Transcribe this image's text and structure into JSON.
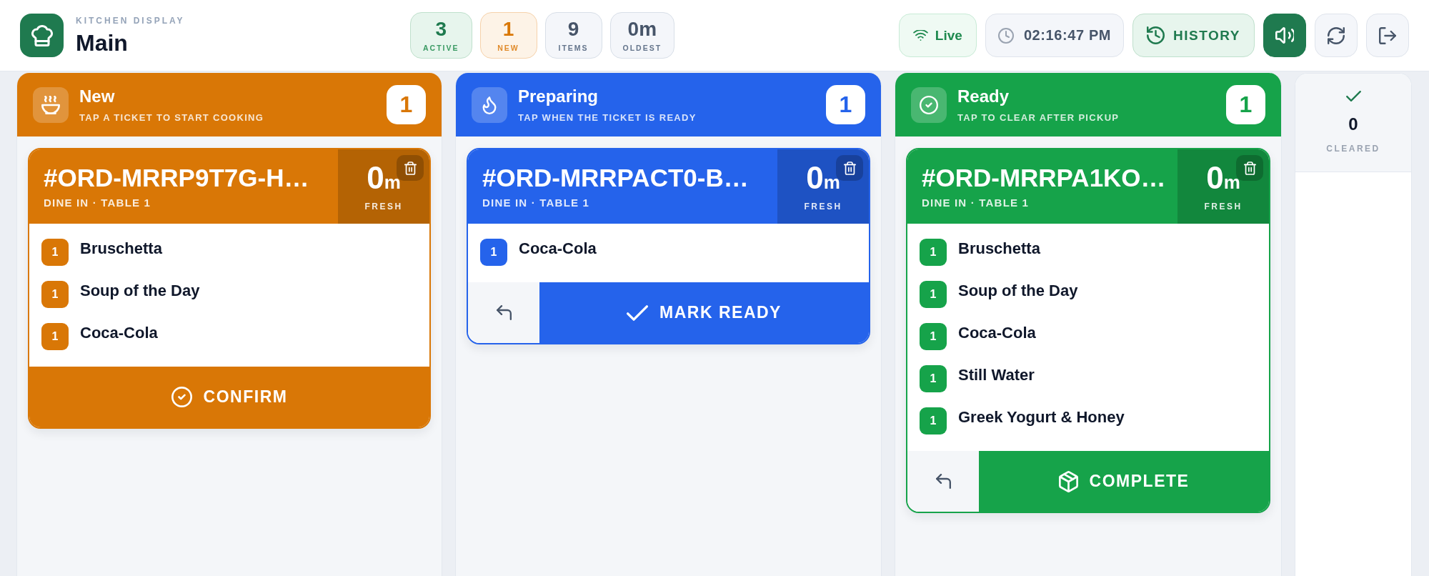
{
  "header": {
    "app_label": "KITCHEN DISPLAY",
    "station": "Main"
  },
  "stats": [
    {
      "kind": "active",
      "value": "3",
      "label": "ACTIVE"
    },
    {
      "kind": "new",
      "value": "1",
      "label": "NEW"
    },
    {
      "kind": "neutral",
      "value": "9",
      "label": "ITEMS"
    },
    {
      "kind": "neutral",
      "value": "0m",
      "label": "OLDEST"
    }
  ],
  "toolbar": {
    "live": {
      "label": "Live",
      "connected": true
    },
    "clock": "02:16:47 PM",
    "history": "HISTORY",
    "sound": {
      "on": true
    }
  },
  "columns": [
    {
      "kind": "new",
      "color": "#d97706",
      "title": "New",
      "subtitle": "TAP A TICKET TO START COOKING",
      "count": "1",
      "tickets": [
        {
          "order": "#ORD-MRRP9T7G-H…",
          "meta": "DINE IN · TABLE 1",
          "age": "0",
          "age_unit": "m",
          "age_label": "FRESH",
          "items": [
            {
              "qty": "1",
              "name": "Bruschetta"
            },
            {
              "qty": "1",
              "name": "Soup of the Day"
            },
            {
              "qty": "1",
              "name": "Coca-Cola"
            }
          ],
          "actions": [
            {
              "kind": "confirm",
              "label": "CONFIRM"
            }
          ]
        }
      ]
    },
    {
      "kind": "preparing",
      "color": "#2563eb",
      "title": "Preparing",
      "subtitle": "TAP WHEN THE TICKET IS READY",
      "count": "1",
      "tickets": [
        {
          "order": "#ORD-MRRPACT0-B…",
          "meta": "DINE IN · TABLE 1",
          "age": "0",
          "age_unit": "m",
          "age_label": "FRESH",
          "items": [
            {
              "qty": "1",
              "name": "Coca-Cola"
            }
          ],
          "actions": [
            {
              "kind": "undo"
            },
            {
              "kind": "ready",
              "label": "MARK READY"
            }
          ]
        }
      ]
    },
    {
      "kind": "ready",
      "color": "#16a34a",
      "title": "Ready",
      "subtitle": "TAP TO CLEAR AFTER PICKUP",
      "count": "1",
      "tickets": [
        {
          "order": "#ORD-MRRPA1KO…",
          "meta": "DINE IN · TABLE 1",
          "age": "0",
          "age_unit": "m",
          "age_label": "FRESH",
          "items": [
            {
              "qty": "1",
              "name": "Bruschetta"
            },
            {
              "qty": "1",
              "name": "Soup of the Day"
            },
            {
              "qty": "1",
              "name": "Coca-Cola"
            },
            {
              "qty": "1",
              "name": "Still Water"
            },
            {
              "qty": "1",
              "name": "Greek Yogurt & Honey"
            }
          ],
          "actions": [
            {
              "kind": "undo"
            },
            {
              "kind": "complete",
              "label": "COMPLETE"
            }
          ]
        }
      ]
    }
  ],
  "cleared": {
    "count": "0",
    "label": "CLEARED"
  }
}
